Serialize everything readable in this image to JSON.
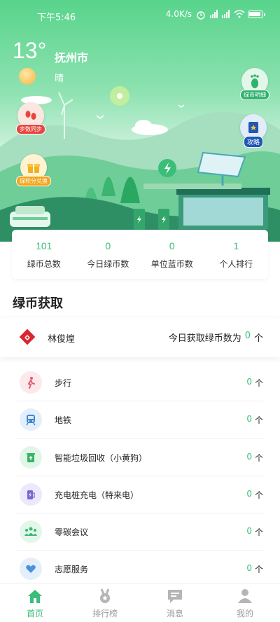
{
  "status_bar": {
    "time": "下午5:46",
    "network_speed": "4.0K/s",
    "alarm_icon": "alarm-icon",
    "signal_icon": "signal-icon",
    "wifi_icon": "wifi-icon",
    "battery_icon": "battery-icon"
  },
  "weather": {
    "temperature": "13°",
    "city": "抚州市",
    "condition": "晴",
    "icon": "sun-icon"
  },
  "float_buttons": {
    "step_sync": "步数同步",
    "points_exchange": "绿积分兑换",
    "coin_details": "绿币明细",
    "guide": "攻略"
  },
  "stats": [
    {
      "value": "101",
      "label": "绿币总数"
    },
    {
      "value": "0",
      "label": "今日绿币数"
    },
    {
      "value": "0",
      "label": "单位蓝币数"
    },
    {
      "value": "1",
      "label": "个人排行"
    }
  ],
  "section_title": "绿币获取",
  "user": {
    "name": "林俊煌",
    "today_prefix": "今日获取绿币数为",
    "today_count": "0",
    "unit": "个"
  },
  "activities": [
    {
      "label": "步行",
      "count": "0",
      "unit": "个",
      "icon": "walking-icon",
      "color": "#f3a7b3"
    },
    {
      "label": "地铁",
      "count": "0",
      "unit": "个",
      "icon": "metro-icon",
      "color": "#9cc8ef"
    },
    {
      "label": "智能垃圾回收（小黄狗）",
      "count": "0",
      "unit": "个",
      "icon": "recycle-bin-icon",
      "color": "#8fd8a4"
    },
    {
      "label": "充电桩充电（特来电）",
      "count": "0",
      "unit": "个",
      "icon": "charging-pile-icon",
      "color": "#b6b1ee"
    },
    {
      "label": "零碳会议",
      "count": "0",
      "unit": "个",
      "icon": "meeting-icon",
      "color": "#93dbb0"
    },
    {
      "label": "志愿服务",
      "count": "0",
      "unit": "个",
      "icon": "volunteer-heart-icon",
      "color": "#9ec7f0"
    }
  ],
  "bottom_nav": [
    {
      "label": "首页",
      "icon": "home-icon",
      "active": true
    },
    {
      "label": "排行榜",
      "icon": "medal-icon",
      "active": false
    },
    {
      "label": "消息",
      "icon": "message-icon",
      "active": false
    },
    {
      "label": "我的",
      "icon": "person-icon",
      "active": false
    }
  ],
  "colors": {
    "accent": "#3bbf78",
    "hero_top": "#58d48b"
  }
}
